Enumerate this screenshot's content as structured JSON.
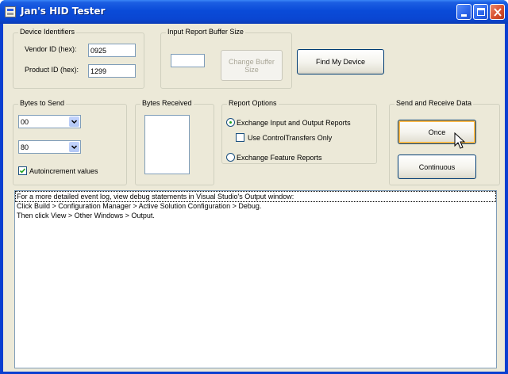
{
  "window": {
    "title": "Jan's HID Tester"
  },
  "device_identifiers": {
    "title": "Device Identifiers",
    "vendor_label": "Vendor ID (hex):",
    "vendor_value": "0925",
    "product_label": "Product ID (hex):",
    "product_value": "1299"
  },
  "input_report_buffer": {
    "title": "Input Report Buffer Size",
    "size_value": "",
    "change_button_label": "Change Buffer Size"
  },
  "find_device_button_label": "Find My Device",
  "bytes_to_send": {
    "title": "Bytes to Send",
    "byte1_value": "00",
    "byte2_value": "80",
    "autoincrement_label": "Autoincrement values",
    "autoincrement_checked": true
  },
  "bytes_received": {
    "title": "Bytes Received"
  },
  "report_options": {
    "title": "Report Options",
    "exchange_io_label": "Exchange Input and Output Reports",
    "exchange_io_selected": true,
    "control_transfers_label": "Use ControlTransfers Only",
    "control_transfers_checked": false,
    "exchange_feature_label": "Exchange Feature Reports",
    "exchange_feature_selected": false
  },
  "send_receive": {
    "title": "Send and Receive Data",
    "once_label": "Once",
    "continuous_label": "Continuous"
  },
  "event_log": {
    "lines": [
      "For a more detailed event log, view debug statements in Visual Studio's Output window:",
      "Click Build > Configuration Manager > Active Solution Configuration > Debug.",
      "Then click View > Other Windows > Output."
    ]
  },
  "icons": [
    "app-icon",
    "minimize-icon",
    "maximize-icon",
    "close-icon",
    "dropdown-arrow-icon",
    "checkmark-icon",
    "mouse-cursor-icon"
  ]
}
